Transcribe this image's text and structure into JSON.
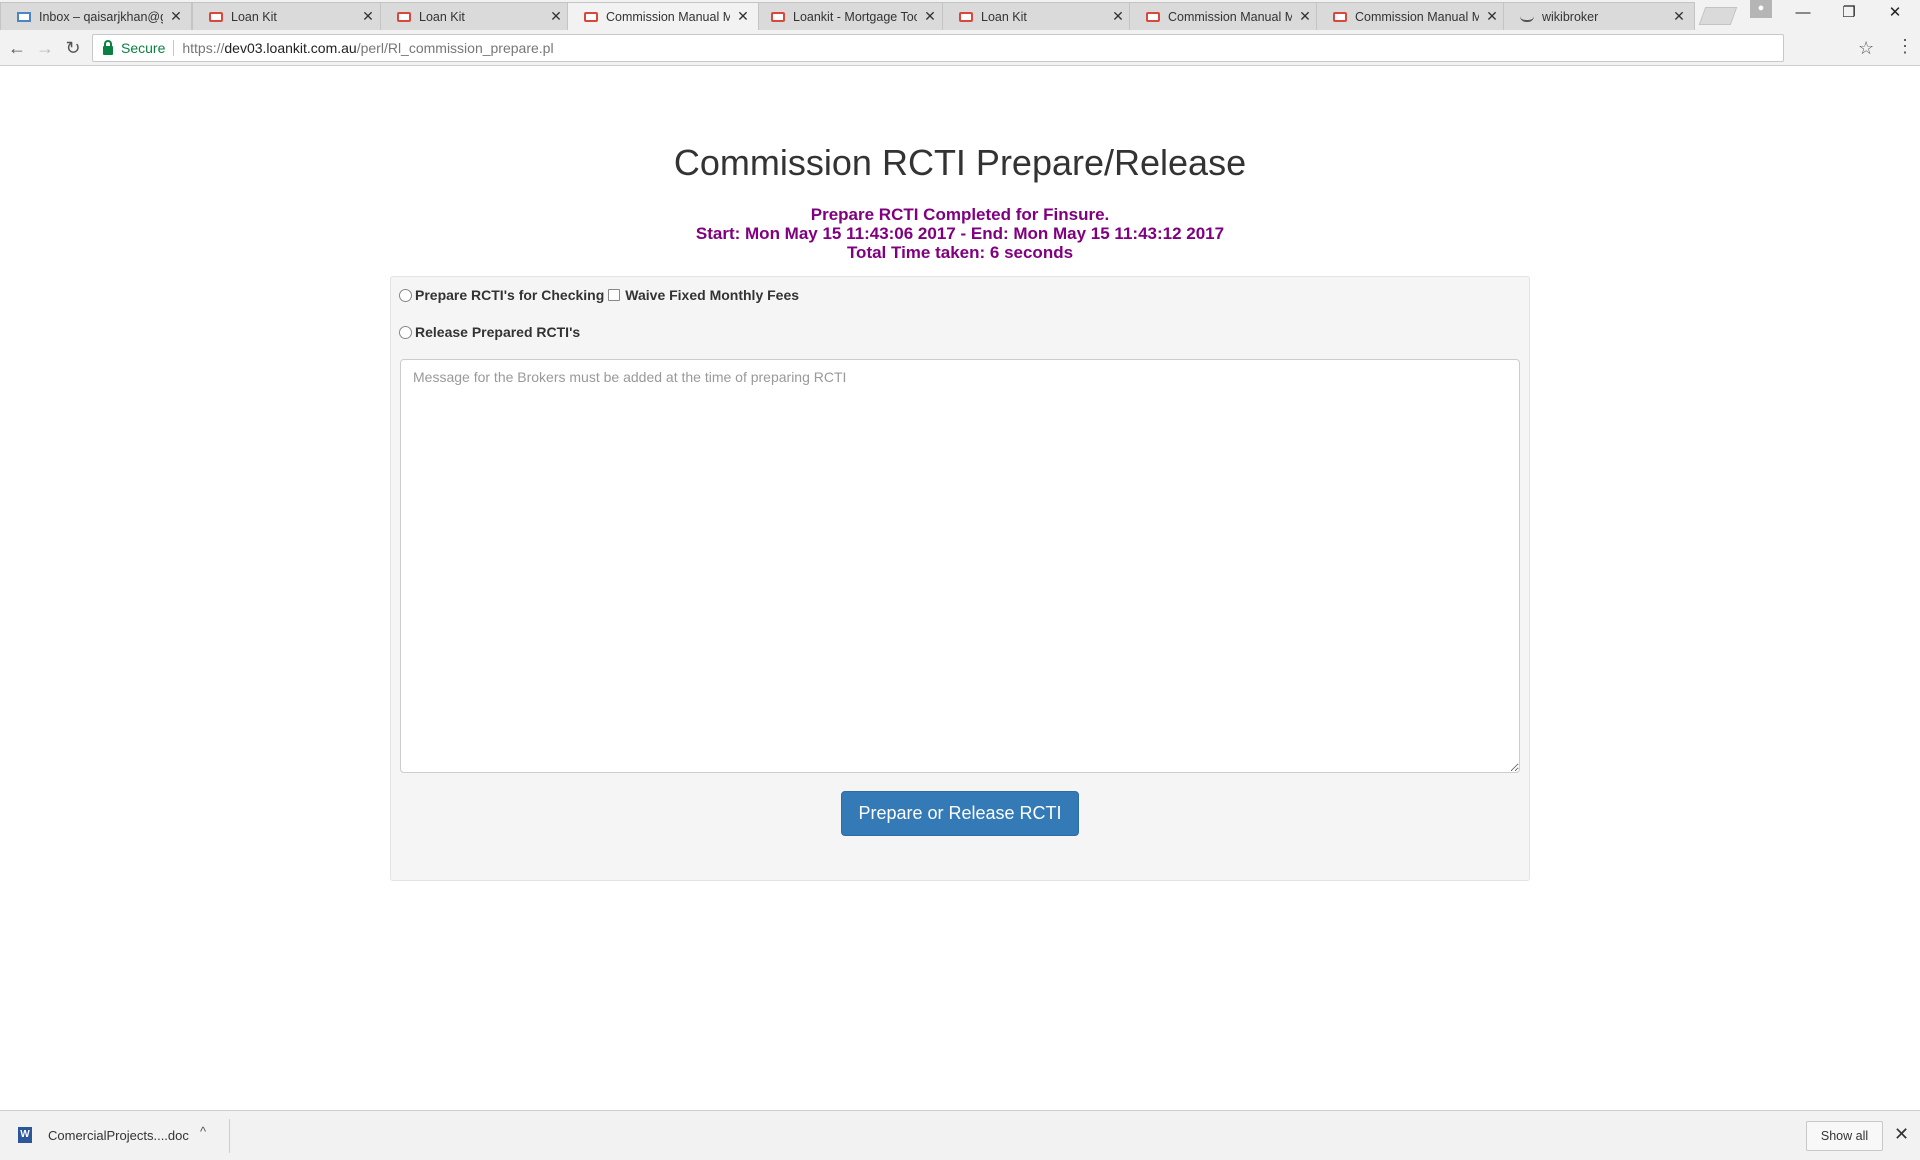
{
  "browser": {
    "tabs": [
      {
        "title": "Inbox – qaisarjkhan@gm",
        "icon": "mail-icon"
      },
      {
        "title": "Loan Kit",
        "icon": "loankit-icon"
      },
      {
        "title": "Loan Kit",
        "icon": "loankit-icon"
      },
      {
        "title": "Commission Manual Ma",
        "icon": "loankit-icon",
        "active": true
      },
      {
        "title": "Loankit - Mortgage Too",
        "icon": "loankit-icon"
      },
      {
        "title": "Loan Kit",
        "icon": "loankit-icon"
      },
      {
        "title": "Commission Manual Ma",
        "icon": "loankit-icon"
      },
      {
        "title": "Commission Manual Ma",
        "icon": "loankit-icon"
      },
      {
        "title": "wikibroker",
        "icon": "wiki-icon"
      }
    ],
    "tab_close_glyph": "✕",
    "window_controls": {
      "minimize": "—",
      "restore": "❐",
      "close": "✕"
    },
    "nav": {
      "back": "←",
      "forward": "→",
      "reload": "↻"
    },
    "address": {
      "secure_label": "Secure",
      "url_scheme": "https://",
      "url_host": "dev03.loankit.com.au",
      "url_path": "/perl/Rl_commission_prepare.pl"
    },
    "bookmark_glyph": "☆",
    "menu_glyph": "⋮"
  },
  "page": {
    "title": "Commission RCTI Prepare/Release",
    "status": {
      "line1": "Prepare RCTI Completed for Finsure.",
      "line2": "Start: Mon May 15 11:43:06 2017 - End: Mon May 15 11:43:12 2017",
      "line3": "Total Time taken: 6 seconds"
    },
    "options": {
      "prepare_label": "Prepare RCTI's for Checking",
      "waive_label": "Waive Fixed Monthly Fees",
      "release_label": "Release Prepared RCTI's"
    },
    "message": {
      "value": "",
      "placeholder": "Message for the Brokers must be added at the time of preparing RCTI"
    },
    "submit_label": "Prepare or Release RCTI"
  },
  "downloads": {
    "file_name": "ComercialProjects....doc",
    "file_icon_glyph": "W",
    "caret": "^",
    "show_all_label": "Show all",
    "close_glyph": "✕"
  },
  "colors": {
    "status_text": "#800080",
    "primary_button": "#337ab7",
    "secure_green": "#0b8043"
  }
}
